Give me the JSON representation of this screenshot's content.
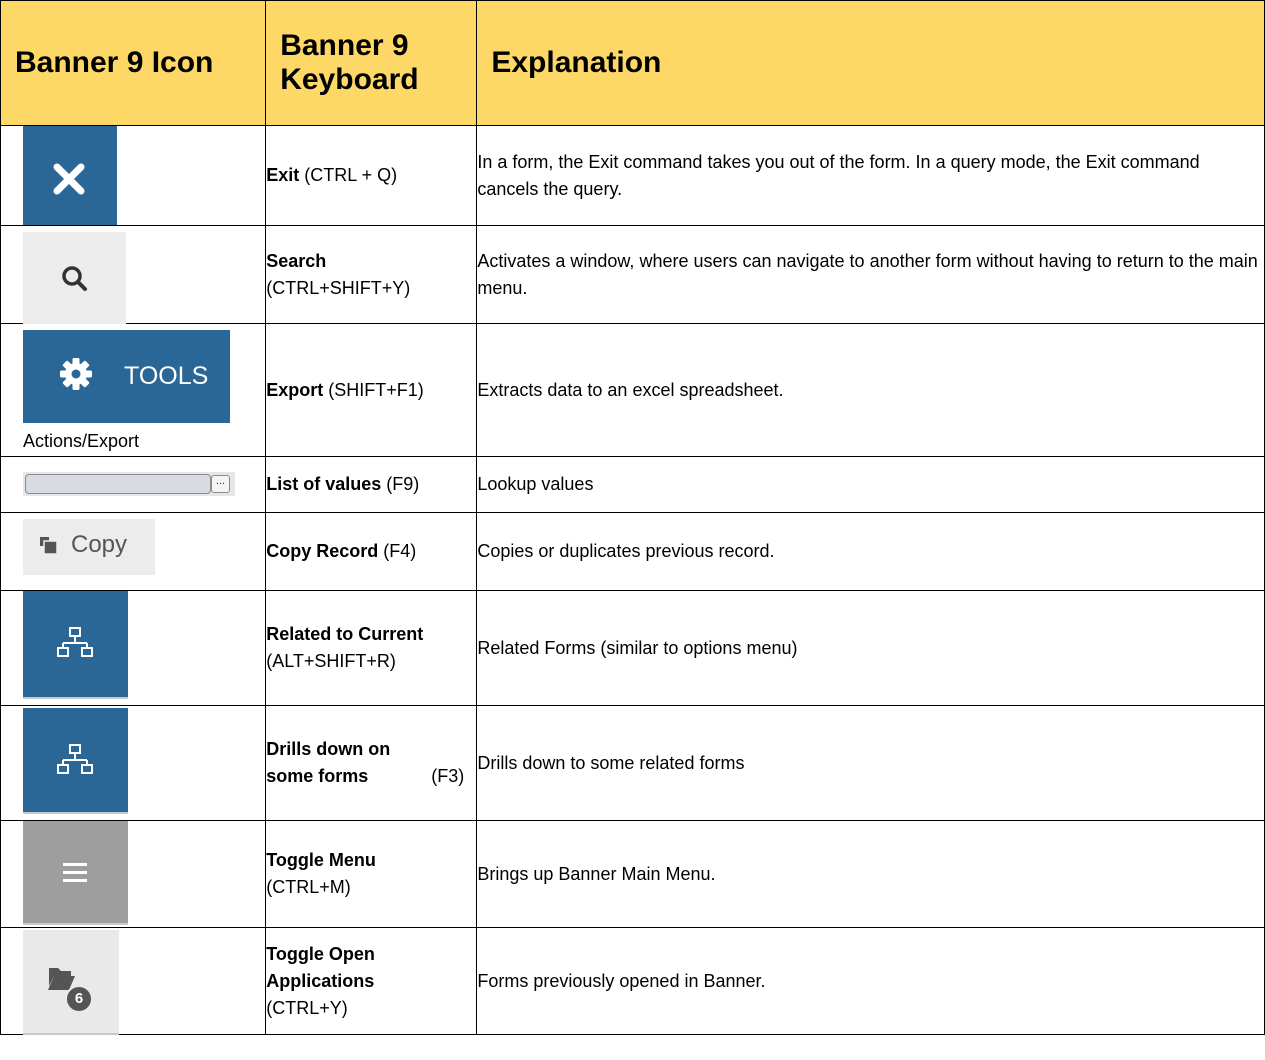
{
  "headers": {
    "icon": "Banner 9 Icon",
    "keyboard": "Banner 9 Keyboard",
    "explanation": "Explanation"
  },
  "colors": {
    "header_bg": "#fdd866",
    "icon_blue": "#2a6797",
    "icon_grey": "#9e9e9e",
    "button_light": "#ececec"
  },
  "rows": [
    {
      "icon": "close-x-icon",
      "name": "Exit",
      "shortcut": "(CTRL + Q)",
      "explanation": "In a form, the Exit command takes you out of the form. In a query mode, the Exit command cancels the query."
    },
    {
      "icon": "search-icon",
      "name": "Search",
      "shortcut": "(CTRL+SHIFT+Y)",
      "explanation": "Activates a  window, where users can navigate to another form without having to return to the main menu."
    },
    {
      "icon": "gear-icon",
      "tools_label": "TOOLS",
      "caption": "Actions/Export",
      "name": "Export",
      "shortcut": "(SHIFT+F1)",
      "explanation": "Extracts data to an excel spreadsheet."
    },
    {
      "icon": "ellipsis-icon",
      "ellipsis": "...",
      "name": "List of values",
      "shortcut": "(F9)",
      "explanation": "Lookup values"
    },
    {
      "icon": "copy-icon",
      "copy_label": "Copy",
      "name": "Copy Record",
      "shortcut": "(F4)",
      "explanation": "Copies or duplicates previous record."
    },
    {
      "icon": "sitemap-icon",
      "name": "Related to Current",
      "shortcut": "(ALT+SHIFT+R)",
      "explanation": "Related Forms (similar to options menu)"
    },
    {
      "icon": "sitemap-icon",
      "name": "Drills down on some forms",
      "shortcut": "(F3)",
      "explanation": "Drills down to some related forms"
    },
    {
      "icon": "hamburger-icon",
      "name": "Toggle Menu",
      "shortcut": "(CTRL+M)",
      "explanation": "Brings up Banner Main Menu."
    },
    {
      "icon": "folder-open-icon",
      "badge": "6",
      "name": "Toggle Open Applications",
      "shortcut": "(CTRL+Y)",
      "explanation": "Forms previously opened in Banner."
    }
  ]
}
